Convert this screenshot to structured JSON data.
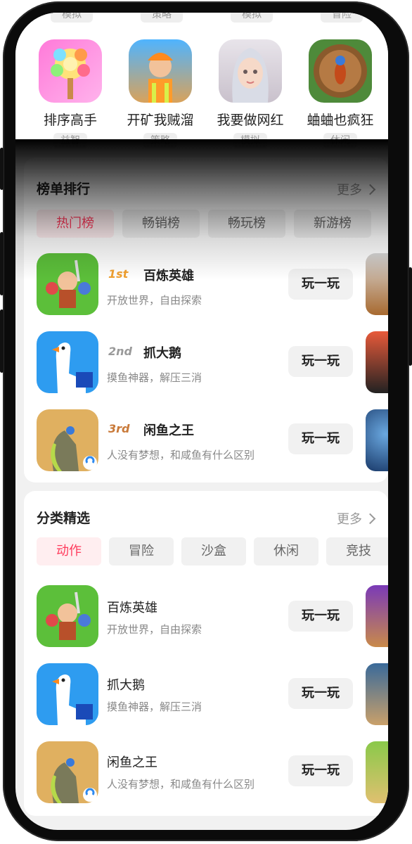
{
  "top_categories": [
    "模拟",
    "策略",
    "模拟",
    "冒险"
  ],
  "featured_games": [
    {
      "name": "排序高手",
      "tag": "益智"
    },
    {
      "name": "开矿我贼溜",
      "tag": "策略"
    },
    {
      "name": "我要做网红",
      "tag": "模拟"
    },
    {
      "name": "蛐蛐也疯狂",
      "tag": "休闲"
    }
  ],
  "rankings": {
    "title": "榜单排行",
    "more": "更多",
    "tabs": [
      "热门榜",
      "畅销榜",
      "畅玩榜",
      "新游榜"
    ],
    "items": [
      {
        "rank": "1st",
        "name": "百炼英雄",
        "desc": "开放世界，自由探索",
        "action": "玩一玩"
      },
      {
        "rank": "2nd",
        "name": "抓大鹅",
        "desc": "摸鱼神器，解压三消",
        "action": "玩一玩"
      },
      {
        "rank": "3rd",
        "name": "闲鱼之王",
        "desc": "人没有梦想，和咸鱼有什么区别",
        "action": "玩一玩"
      }
    ]
  },
  "categories": {
    "title": "分类精选",
    "more": "更多",
    "tabs": [
      "动作",
      "冒险",
      "沙盒",
      "休闲",
      "竞技"
    ],
    "items": [
      {
        "name": "百炼英雄",
        "desc": "开放世界，自由探索",
        "action": "玩一玩"
      },
      {
        "name": "抓大鹅",
        "desc": "摸鱼神器，解压三消",
        "action": "玩一玩"
      },
      {
        "name": "闲鱼之王",
        "desc": "人没有梦想，和咸鱼有什么区别",
        "action": "玩一玩"
      }
    ]
  },
  "colors": {
    "accent": "#ff3b5c",
    "rank_gold": "#f0a030",
    "rank_silver": "#9a9a9a",
    "rank_bronze": "#c97a3a"
  }
}
